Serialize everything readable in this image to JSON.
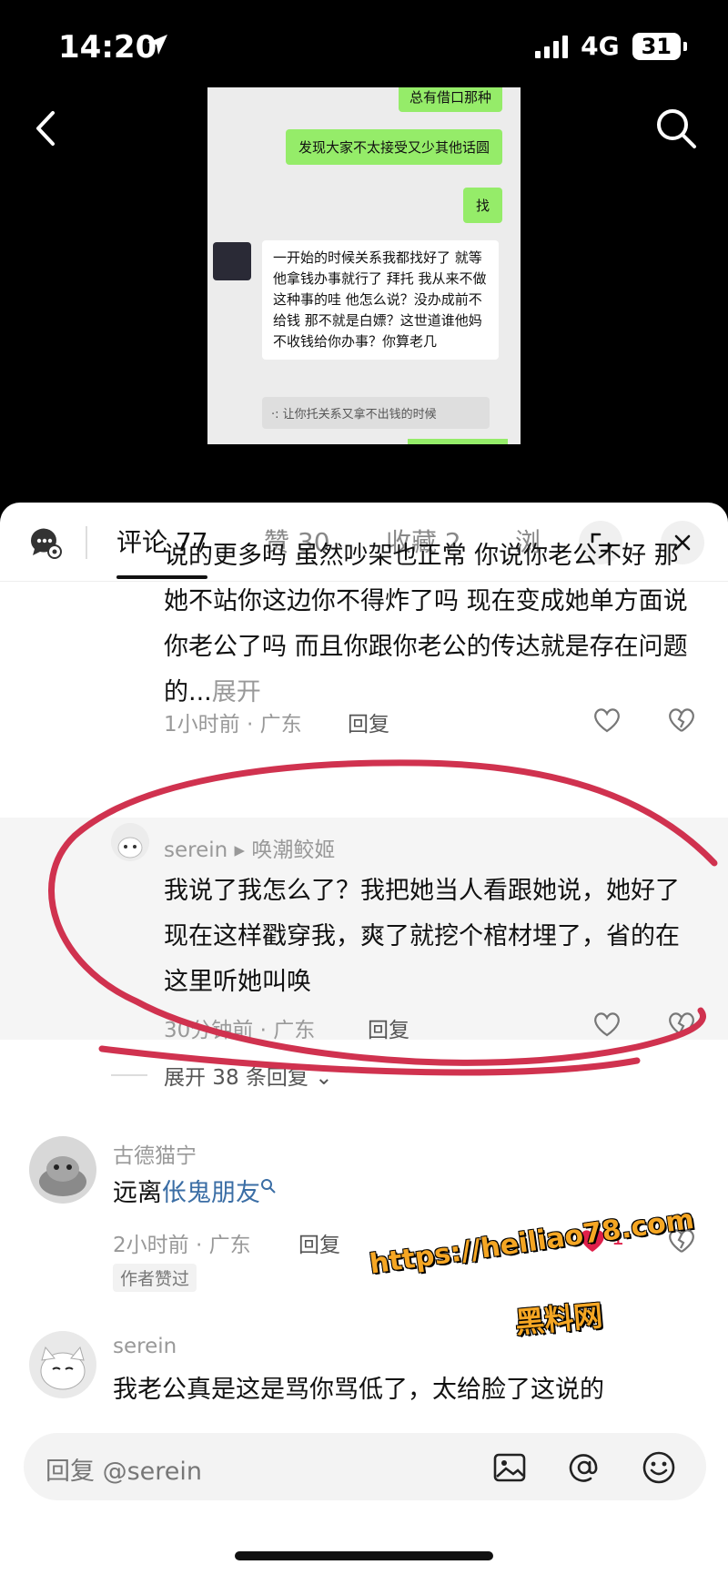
{
  "status": {
    "time": "14:20",
    "network": "4G",
    "battery": "31"
  },
  "screenshot": {
    "bubbles_green": [
      "总有借口那种",
      "发现大家不太接受又少其他话圆",
      "找"
    ],
    "bubble_white": "一开始的时候关系我都找好了 就等他拿钱办事就行了 拜托 我从来不做这种事的哇 他怎么说？没办成前不给钱 那不就是白嫖？这世道谁他妈不收钱给你办事？你算老几",
    "quote": "·: 让你托关系又拿不出钱的时候"
  },
  "tabs": [
    {
      "label": "评论 77"
    },
    {
      "label": "赞 30"
    },
    {
      "label": "收藏 2"
    },
    {
      "label": "浏"
    }
  ],
  "comments": {
    "c1": {
      "text": "说的更多吗  虽然吵架也正常  你说你老公不好  那她不站你这边你不得炸了吗  现在变成她单方面说你老公了吗  而且你跟你老公的传达就是存在问题的...",
      "expand": "展开",
      "meta": "1小时前 · 广东",
      "reply": "回复"
    },
    "c2": {
      "user": "serein ▸ 唤潮鲛姬",
      "text": "我说了我怎么了？我把她当人看跟她说，她好了现在这样戳穿我，爽了就挖个棺材埋了，省的在这里听她叫唤",
      "meta": "30分钟前 · 广东",
      "reply": "回复"
    },
    "more_replies": "展开 38 条回复 ⌄",
    "c3": {
      "user": "古德猫宁",
      "text_prefix": "远离",
      "text_link": "伥鬼朋友",
      "meta": "2小时前 · 广东",
      "reply": "回复",
      "likes": "1",
      "badge": "作者赞过"
    },
    "c4": {
      "user": "serein",
      "text": "我老公真是这是骂你骂低了，太给脸了这说的"
    }
  },
  "watermark": {
    "url": "https://heiliao78.com",
    "name": "黑料网"
  },
  "input": {
    "placeholder": "回复 @serein"
  },
  "colors": {
    "bubble_green": "#95ec69",
    "link_blue": "#3b6ea5",
    "circle_red": "#d0324f",
    "like_red": "#e0204a"
  }
}
